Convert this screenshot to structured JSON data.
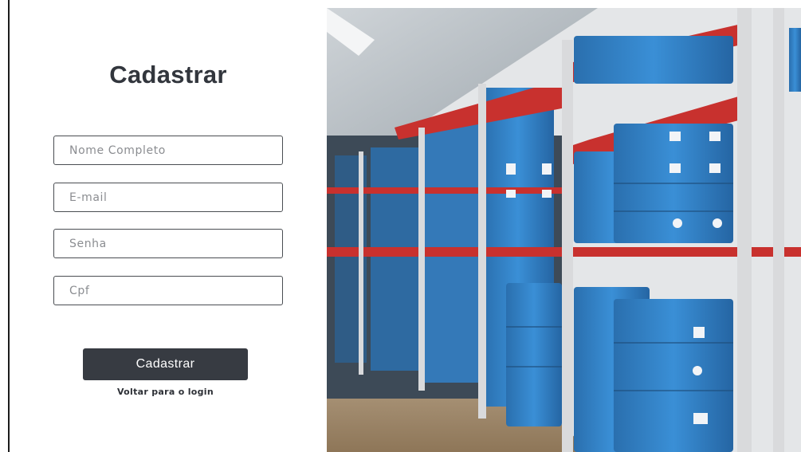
{
  "form": {
    "title": "Cadastrar",
    "fields": {
      "name_placeholder": "Nome Completo",
      "email_placeholder": "E-mail",
      "password_placeholder": "Senha",
      "cpf_placeholder": "Cpf"
    },
    "submit_label": "Cadastrar",
    "back_to_login": "Voltar para o login"
  },
  "image": {
    "subject": "warehouse-shelves-with-blue-bins-icon"
  },
  "colors": {
    "button_bg": "#373b42",
    "title": "#32363d",
    "shelf_red": "#c8312e",
    "bin_blue": "#2f7fc4"
  }
}
